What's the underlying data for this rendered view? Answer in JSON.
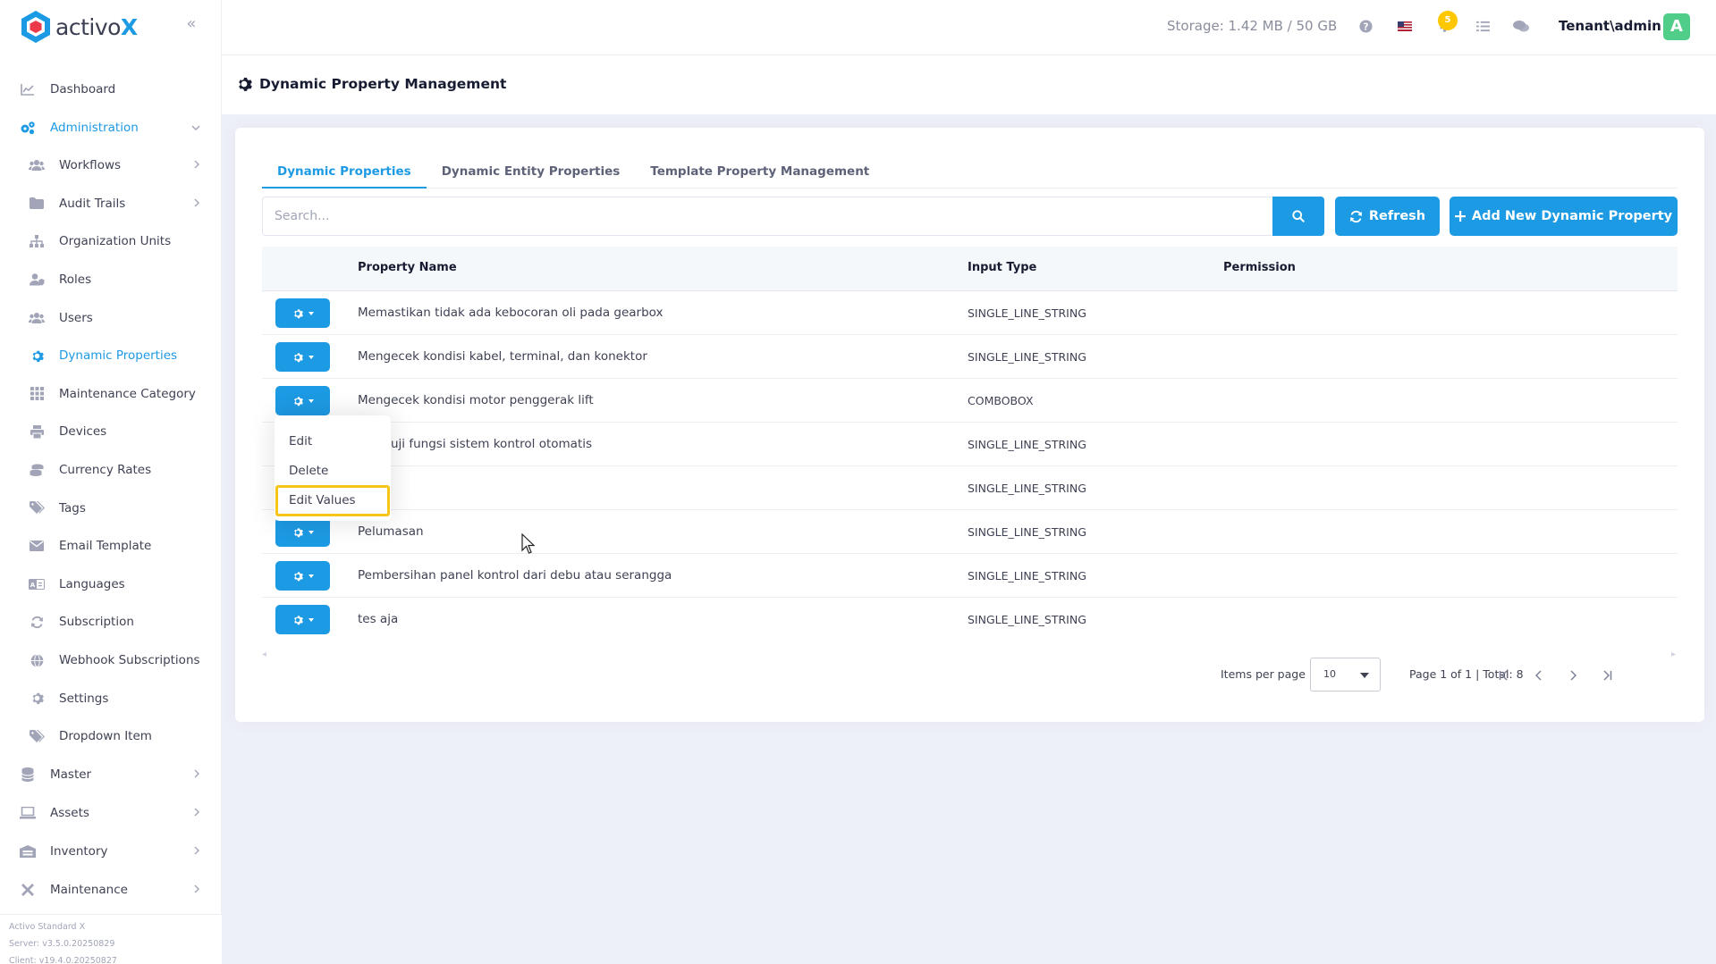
{
  "brand": {
    "name_main": "activo",
    "name_accent": "X"
  },
  "sidebar": {
    "items": [
      {
        "label": "Dashboard",
        "icon": "chart-line-icon",
        "level": 0
      },
      {
        "label": "Administration",
        "icon": "cogs-icon",
        "level": 0,
        "expanded": true
      },
      {
        "label": "Workflows",
        "icon": "users-icon",
        "level": 1,
        "chevron": true
      },
      {
        "label": "Audit Trails",
        "icon": "folder-icon",
        "level": 1,
        "chevron": true
      },
      {
        "label": "Organization Units",
        "icon": "sitemap-icon",
        "level": 1
      },
      {
        "label": "Roles",
        "icon": "user-shield-icon",
        "level": 1
      },
      {
        "label": "Users",
        "icon": "users-icon",
        "level": 1
      },
      {
        "label": "Dynamic Properties",
        "icon": "gear-icon",
        "level": 1,
        "selected": true
      },
      {
        "label": "Maintenance Category",
        "icon": "grid-icon",
        "level": 1
      },
      {
        "label": "Devices",
        "icon": "print-icon",
        "level": 1
      },
      {
        "label": "Currency Rates",
        "icon": "coins-icon",
        "level": 1
      },
      {
        "label": "Tags",
        "icon": "tags-icon",
        "level": 1
      },
      {
        "label": "Email Template",
        "icon": "envelope-icon",
        "level": 1
      },
      {
        "label": "Languages",
        "icon": "language-icon",
        "level": 1
      },
      {
        "label": "Subscription",
        "icon": "sync-icon",
        "level": 1
      },
      {
        "label": "Webhook Subscriptions",
        "icon": "globe-icon",
        "level": 1
      },
      {
        "label": "Settings",
        "icon": "gear-icon",
        "level": 1
      },
      {
        "label": "Dropdown Item",
        "icon": "tags-icon",
        "level": 1
      },
      {
        "label": "Master",
        "icon": "database-icon",
        "level": 0,
        "chevron": true
      },
      {
        "label": "Assets",
        "icon": "laptop-icon",
        "level": 0,
        "chevron": true
      },
      {
        "label": "Inventory",
        "icon": "warehouse-icon",
        "level": 0,
        "chevron": true
      },
      {
        "label": "Maintenance",
        "icon": "tools-icon",
        "level": 0,
        "chevron": true
      }
    ],
    "footer": {
      "product": "Activo Standard X",
      "server": "Server: v3.5.0.20250829",
      "client": "Client: v19.4.0.20250827"
    }
  },
  "header": {
    "storage": "Storage: 1.42 MB / 50 GB",
    "notification_count": "5",
    "user": "Tenant\\admin",
    "avatar_letter": "A"
  },
  "page": {
    "title": "Dynamic Property Management",
    "tabs": [
      {
        "label": "Dynamic Properties",
        "active": true
      },
      {
        "label": "Dynamic Entity Properties",
        "active": false
      },
      {
        "label": "Template Property Management",
        "active": false
      }
    ],
    "search_placeholder": "Search...",
    "refresh_label": "Refresh",
    "add_label": "Add New Dynamic Property"
  },
  "table": {
    "columns": {
      "name": "Property Name",
      "type": "Input Type",
      "permission": "Permission"
    },
    "rows": [
      {
        "name": "Memastikan tidak ada kebocoran oli pada gearbox",
        "type": "SINGLE_LINE_STRING",
        "permission": ""
      },
      {
        "name": "Mengecek kondisi kabel, terminal, dan konektor",
        "type": "SINGLE_LINE_STRING",
        "permission": ""
      },
      {
        "name": "Mengecek kondisi motor penggerak lift",
        "type": "COMBOBOX",
        "permission": ""
      },
      {
        "name": "uji fungsi sistem kontrol otomatis",
        "type": "SINGLE_LINE_STRING",
        "permission": ""
      },
      {
        "name": "",
        "type": "SINGLE_LINE_STRING",
        "permission": ""
      },
      {
        "name": "Pelumasan",
        "type": "SINGLE_LINE_STRING",
        "permission": ""
      },
      {
        "name": "Pembersihan panel kontrol dari debu atau serangga",
        "type": "SINGLE_LINE_STRING",
        "permission": ""
      },
      {
        "name": "tes aja",
        "type": "SINGLE_LINE_STRING",
        "permission": ""
      }
    ]
  },
  "dropdown": {
    "items": [
      {
        "label": "Edit"
      },
      {
        "label": "Delete"
      },
      {
        "label": "Edit Values",
        "highlighted": true
      }
    ]
  },
  "pagination": {
    "items_per_page_label": "Items per page",
    "items_per_page_value": "10",
    "page_info": "Page 1 of 1 | Total: 8"
  },
  "colors": {
    "primary": "#1d9ae4",
    "highlight": "#f5c518",
    "badge": "#ffc700",
    "avatar": "#50cd89"
  }
}
